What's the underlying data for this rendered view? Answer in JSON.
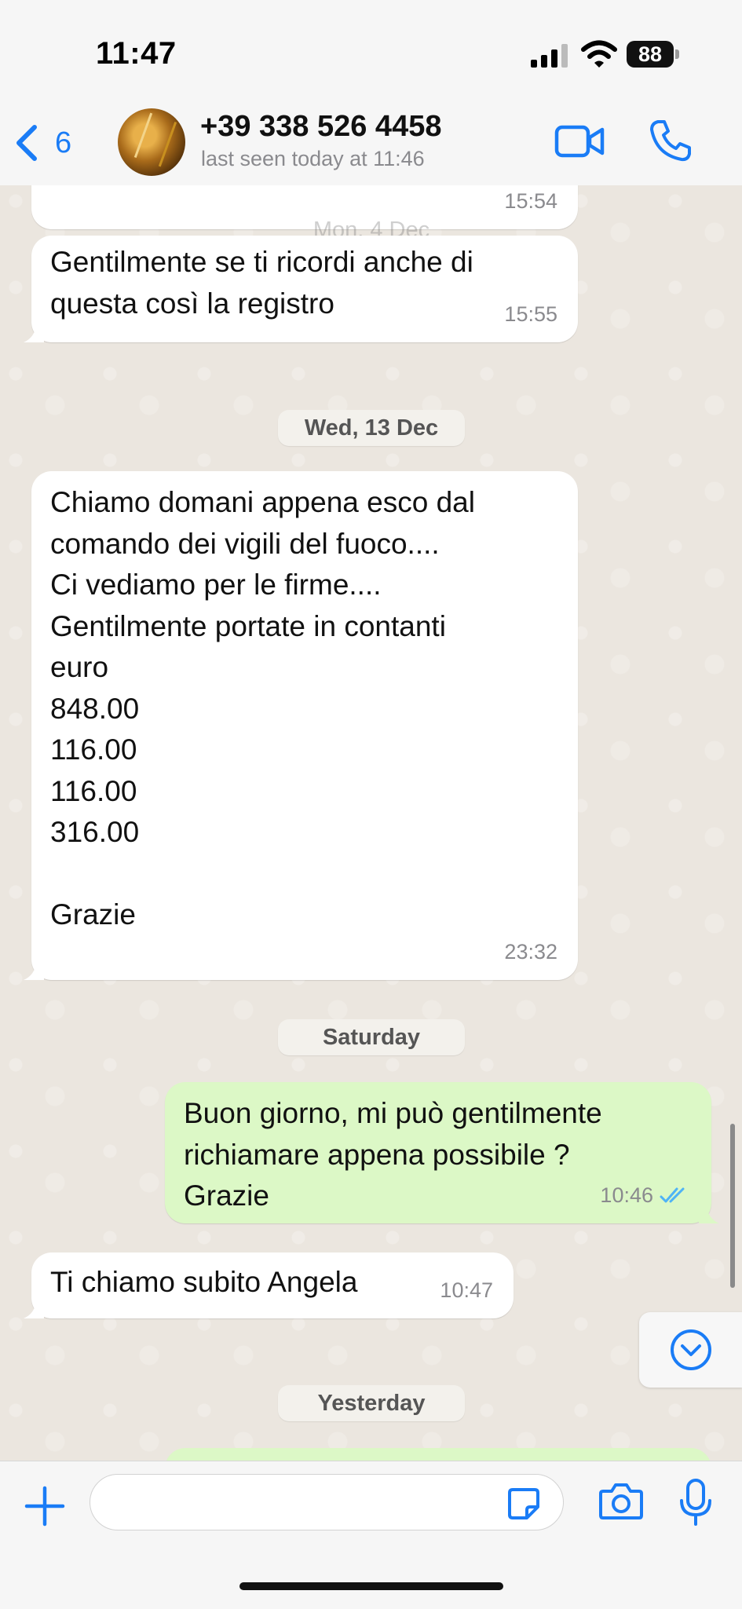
{
  "status_bar": {
    "time": "11:47",
    "battery": "88"
  },
  "header": {
    "back_count": "6",
    "contact_name": "+39 338 526 4458",
    "contact_status": "last seen today at 11:46"
  },
  "messages": [
    {
      "direction": "in",
      "text": "",
      "time": "15:54"
    },
    {
      "direction": "in",
      "text": "Gentilmente se ti ricordi anche di\nquesta così la registro",
      "time": "15:55"
    },
    {
      "direction": "in",
      "text": "Chiamo domani appena esco dal\ncomando dei vigili del fuoco....\nCi vediamo per le firme....\nGentilmente portate in contanti\neuro\n848.00\n116.00\n116.00\n316.00\n\nGrazie",
      "time": "23:32"
    },
    {
      "direction": "out",
      "text": "Buon giorno, mi può gentilmente\nrichiamare appena possibile ?\nGrazie",
      "time": "10:46",
      "status": "read"
    },
    {
      "direction": "in",
      "text": "Ti chiamo subito Angela",
      "time": "10:47"
    }
  ],
  "date_separators": [
    "Mon, 4 Dec",
    "Wed, 13 Dec",
    "Saturday",
    "Yesterday"
  ],
  "composer": {
    "placeholder": ""
  },
  "colors": {
    "accent": "#1a7cf6",
    "outgoing_bubble": "#dcf8c6",
    "incoming_bubble": "#ffffff",
    "read_ticks": "#4fb3f6"
  }
}
